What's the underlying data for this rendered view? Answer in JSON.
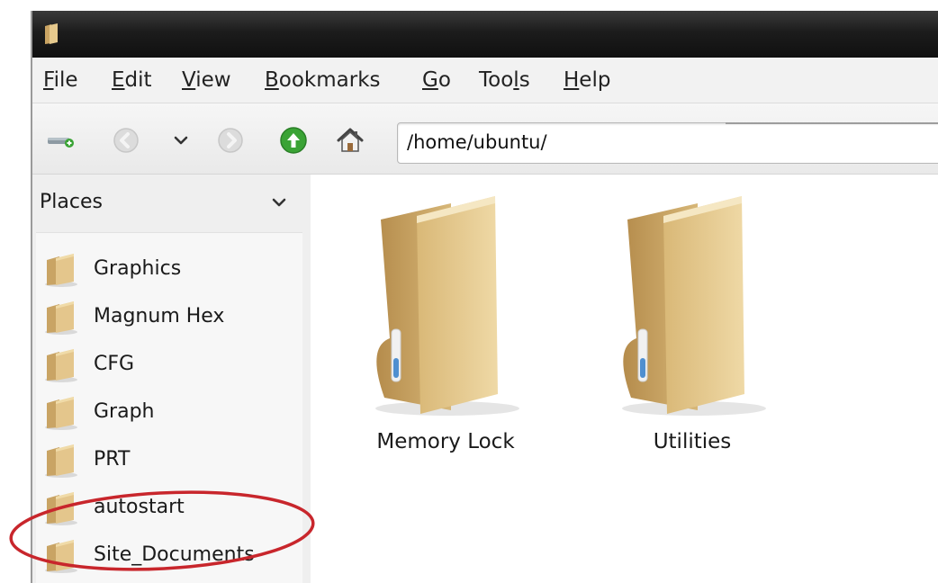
{
  "window": {
    "titlebar_icon": "folder-icon"
  },
  "menubar": {
    "items": [
      {
        "pre": "",
        "key": "F",
        "post": "ile"
      },
      {
        "pre": "",
        "key": "E",
        "post": "dit"
      },
      {
        "pre": "",
        "key": "V",
        "post": "iew"
      },
      {
        "pre": "",
        "key": "B",
        "post": "ookmarks"
      },
      {
        "pre": "",
        "key": "G",
        "post": "o"
      },
      {
        "pre": "Too",
        "key": "l",
        "post": "s"
      },
      {
        "pre": "",
        "key": "H",
        "post": "elp"
      }
    ]
  },
  "toolbar": {
    "icons": [
      "new-folder-icon",
      "back-icon",
      "history-dropdown-icon",
      "forward-icon",
      "up-icon",
      "home-icon"
    ],
    "location": "/home/ubuntu/"
  },
  "sidebar": {
    "title": "Places",
    "items": [
      {
        "label": "Graphics"
      },
      {
        "label": "Magnum Hex"
      },
      {
        "label": "CFG"
      },
      {
        "label": "Graph"
      },
      {
        "label": "PRT"
      },
      {
        "label": "autostart"
      },
      {
        "label": "Site_Documents"
      }
    ]
  },
  "main": {
    "folders": [
      {
        "label": "Memory Lock"
      },
      {
        "label": "Utilities"
      }
    ]
  },
  "colors": {
    "annotation": "#c8262c",
    "folder": "#e0c38a",
    "up_button": "#3aa335"
  }
}
